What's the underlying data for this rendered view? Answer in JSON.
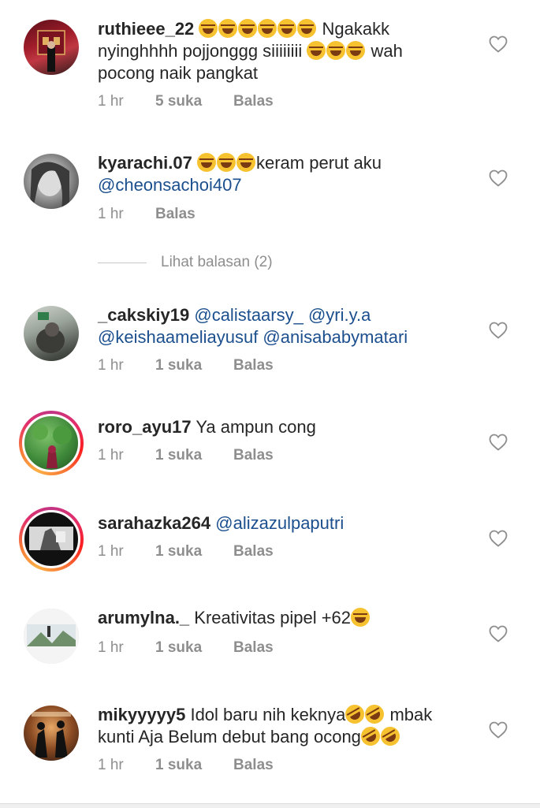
{
  "comments": [
    {
      "username": "ruthieee_22",
      "emoji_before": 6,
      "text": "Ngakakk nyinghhhh pojjonggg siiiiiiii",
      "emoji_mid": 3,
      "text2": "wah pocong naik pangkat",
      "time": "1 hr",
      "likes": "5 suka",
      "reply": "Balas"
    },
    {
      "username": "kyarachi.07",
      "emoji_before": 3,
      "text": "keram perut aku",
      "mention": "@cheonsachoi407",
      "time": "1 hr",
      "reply": "Balas"
    },
    {
      "username": "_cakskiy19",
      "mention": "@calistaarsy_ @yri.y.a @keishaameliayusuf @anisababymatari",
      "time": "1 hr",
      "likes": "1 suka",
      "reply": "Balas"
    },
    {
      "username": "roro_ayu17",
      "text": "Ya ampun cong",
      "time": "1 hr",
      "likes": "1 suka",
      "reply": "Balas"
    },
    {
      "username": "sarahazka264",
      "mention": "@alizazulpaputri",
      "time": "1 hr",
      "likes": "1 suka",
      "reply": "Balas"
    },
    {
      "username": "arumylna._",
      "text": "Kreativitas pipel +62",
      "emoji_after": 1,
      "time": "1 hr",
      "likes": "1 suka",
      "reply": "Balas"
    },
    {
      "username": "mikyyyyy5",
      "text": "Idol baru nih keknya",
      "emoji_mid": 2,
      "text2": "mbak kunti Aja Belum debut bang ocong",
      "emoji_after": 2,
      "time": "1 hr",
      "likes": "1 suka",
      "reply": "Balas"
    }
  ],
  "view_replies": "Lihat balasan (2)",
  "icons": {
    "like": "heart-outline-icon",
    "emoji_laugh": "face-with-tears-of-joy-icon",
    "emoji_rofl": "rolling-on-floor-laughing-icon"
  },
  "colors": {
    "mention": "#1b4f8e",
    "meta": "#8e8e8e",
    "story_ring": "#e1306c"
  }
}
